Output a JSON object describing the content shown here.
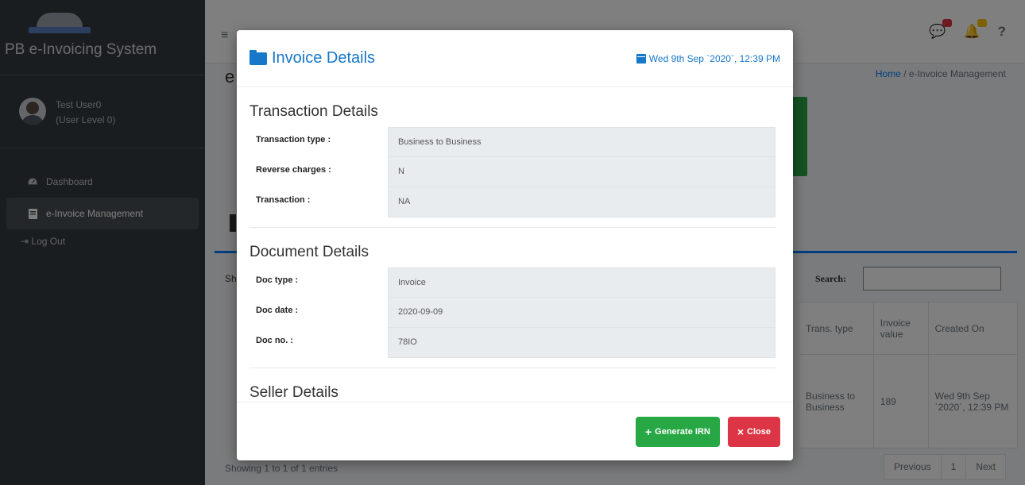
{
  "app": {
    "brand_name": "PB e-Invoicing System",
    "user_name": "Test User0",
    "user_level": "(User Level 0)"
  },
  "sidebar": {
    "items": [
      {
        "label": "Dashboard",
        "icon": "dashboard-icon"
      },
      {
        "label": "e-Invoice Management",
        "icon": "document-icon"
      }
    ],
    "logout": "Log Out"
  },
  "background": {
    "page_title_initial": "e",
    "breadcrumb_home": "Home",
    "breadcrumb_sep": " / ",
    "breadcrumb_current": "e-Invoice Management",
    "search_label": "Search:",
    "show_fragment": "Sh",
    "table_headers": [
      "Trans. type",
      "Invoice value",
      "Created On"
    ],
    "table_row": [
      "Business to Business",
      "189",
      "Wed 9th Sep `2020`, 12:39 PM"
    ],
    "showing": "Showing 1 to 1 of 1 entries",
    "pager": [
      "Previous",
      "1",
      "Next"
    ]
  },
  "modal": {
    "title": "Invoice Details",
    "datetime": "Wed 9th Sep `2020`, 12:39 PM",
    "sections": {
      "transaction": {
        "title": "Transaction Details",
        "fields": [
          {
            "label": "Transaction type :",
            "value": "Business to Business"
          },
          {
            "label": "Reverse charges :",
            "value": "N"
          },
          {
            "label": "Transaction :",
            "value": "NA"
          }
        ]
      },
      "document": {
        "title": "Document Details",
        "fields": [
          {
            "label": "Doc type :",
            "value": "Invoice"
          },
          {
            "label": "Doc date :",
            "value": "2020-09-09"
          },
          {
            "label": "Doc no. :",
            "value": "78IO"
          }
        ]
      },
      "seller": {
        "title": "Seller Details"
      }
    },
    "buttons": {
      "generate": "Generate IRN",
      "close": "Close"
    }
  },
  "colors": {
    "accent": "#1777c9",
    "success": "#28a745",
    "danger": "#dc3545",
    "sidebar": "#343a40"
  }
}
